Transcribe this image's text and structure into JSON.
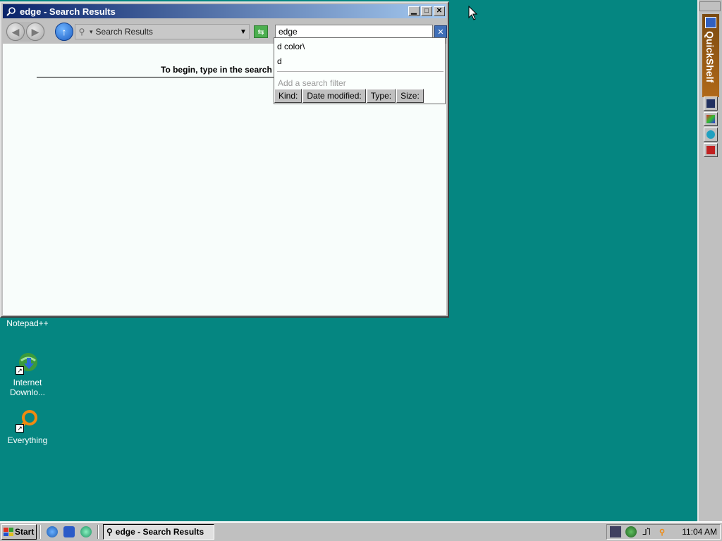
{
  "window": {
    "title": "edge - Search Results",
    "address_text": "Search Results",
    "search_value": "edge",
    "content_hint": "To begin, type in the search"
  },
  "dropdown": {
    "suggestions": [
      "d color\\",
      "d"
    ],
    "filter_label": "Add a search filter",
    "filters": [
      "Kind:",
      "Date modified:",
      "Type:",
      "Size:"
    ]
  },
  "desktop": {
    "icons": [
      {
        "label": "Notepad++",
        "icon": "notepad-icon"
      },
      {
        "label": "Internet Downlo...",
        "icon": "internet-download-manager-icon"
      },
      {
        "label": "Everything",
        "icon": "everything-search-icon"
      }
    ]
  },
  "quickshelf": {
    "label": "QuickShelf"
  },
  "taskbar": {
    "start_label": "Start",
    "task_label": "edge - Search Results",
    "clock": "11:04 AM"
  },
  "colors": {
    "desktop_bg": "#058681",
    "title_gradient_start": "#0a246a",
    "title_gradient_end": "#a6caf0",
    "window_bg": "#c0c0c0"
  }
}
